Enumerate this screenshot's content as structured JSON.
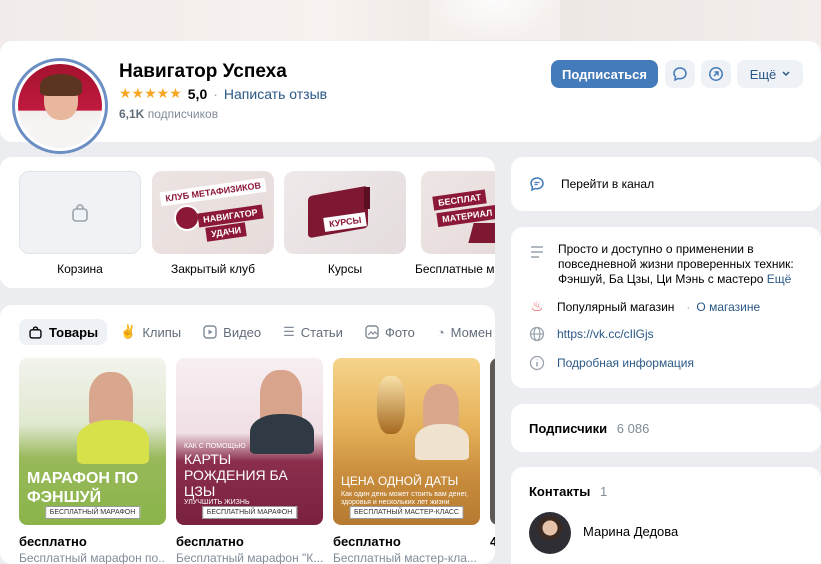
{
  "header": {
    "title": "Навигатор Успеха",
    "rating_stars": "★★★★★",
    "rating_value": "5,0",
    "rating_sep": "·",
    "write_review": "Написать отзыв",
    "subscribers_count": "6,1K",
    "subscribers_label": "подписчиков",
    "subscribe_button": "Подписаться",
    "more_button": "Ещё"
  },
  "shop": {
    "items": [
      {
        "label": "Корзина"
      },
      {
        "label": "Закрытый клуб",
        "tag1": "КЛУБ МЕТАФИЗИКОВ",
        "tag2": "НАВИГАТОР",
        "tag3": "УДАЧИ"
      },
      {
        "label": "Курсы",
        "tag1": "КУРСЫ"
      },
      {
        "label": "Бесплатные м",
        "tag1": "БЕСПЛАТ",
        "tag2": "МАТЕРИАЛ"
      }
    ]
  },
  "tabs": [
    {
      "label": "Товары",
      "icon": "bag-icon",
      "glyph": "🛍"
    },
    {
      "label": "Клипы",
      "icon": "clips-icon",
      "glyph": "✌"
    },
    {
      "label": "Видео",
      "icon": "video-icon",
      "glyph": "▶"
    },
    {
      "label": "Статьи",
      "icon": "articles-icon",
      "glyph": "☰"
    },
    {
      "label": "Фото",
      "icon": "photo-icon",
      "glyph": "▣"
    },
    {
      "label": "Момен",
      "icon": "moments-icon",
      "glyph": "◔"
    }
  ],
  "products": [
    {
      "price": "бесплатно",
      "title": "Бесплатный марафон по...",
      "big": "МАРАФОН ПО ФЭНШУЙ",
      "badge": "БЕСПЛАТНЫЙ МАРАФОН"
    },
    {
      "price": "бесплатно",
      "title": "Бесплатный марафон \"К...",
      "small": "КАК С ПОМОЩЬЮ",
      "big": "КАРТЫ РОЖДЕНИЯ БА ЦЗЫ",
      "extra": "УЛУЧШИТЬ ЖИЗНЬ",
      "badge": "БЕСПЛАТНЫЙ МАРАФОН"
    },
    {
      "price": "бесплатно",
      "title": "Бесплатный мастер-кла...",
      "big": "ЦЕНА ОДНОЙ ДАТЫ",
      "small": "Как один день может стоить вам денег, здоровья и нескольких лет жизни",
      "badge": "БЕСПЛАТНЫЙ МАСТЕР-КЛАСС"
    },
    {
      "price": "4"
    }
  ],
  "right": {
    "channel": "Перейти в канал",
    "description": "Просто и доступно о применении в повседневной жизни проверенных техник: Фэншуй, Ба Цзы, Ци Мэнь с мастеро",
    "description_more": "Ещё",
    "popular_shop": "Популярный магазин",
    "about_shop": "О магазине",
    "link": "https://vk.cc/cIlGjs",
    "details": "Подробная информация",
    "subscribers_title": "Подписчики",
    "subscribers_count": "6 086",
    "contacts_title": "Контакты",
    "contacts_count": "1",
    "contact_name": "Марина Дедова"
  },
  "colors": {
    "accent": "#447bba",
    "link": "#2a5885",
    "star": "#f5a623",
    "fire": "#e64646"
  }
}
